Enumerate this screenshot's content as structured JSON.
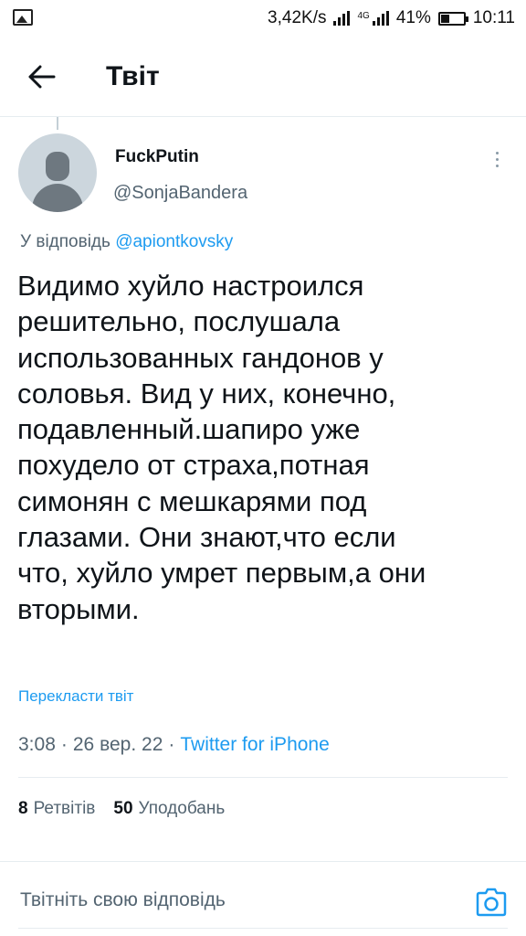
{
  "status_bar": {
    "network_speed": "3,42K/s",
    "network_type": "4G",
    "battery_percent": "41%",
    "battery_level": 0.41,
    "time": "10:11",
    "icons": [
      "gallery-icon",
      "signal-icon",
      "battery-icon"
    ]
  },
  "header": {
    "title": "Твіт",
    "back_icon": "arrow-left-icon"
  },
  "tweet": {
    "author_name": "FuckPutin",
    "author_handle": "@SonjaBandera",
    "reply_prefix": "У відповідь",
    "reply_to": "@apiontkovsky",
    "text": "Видимо хуйло настроился\nрешительно, послушала\nиспользованных гандонов у\nсоловья. Вид у них, конечно,\nподавленный.шапиро уже\nпохудело от страха,потная\nсимонян с мешкарями под\nглазами. Они знают,что если\nчто, хуйло умрет первым,а они\nвторыми.",
    "translate_label": "Перекласти твіт",
    "time": "3:08",
    "date": "26 вер. 22",
    "separator": "·",
    "source": "Twitter for iPhone",
    "retweets_count": "8",
    "retweets_label": "Ретвітів",
    "likes_count": "50",
    "likes_label": "Уподобань"
  },
  "reply_bar": {
    "placeholder": "Твітніть свою відповідь",
    "camera_icon": "camera-icon"
  },
  "colors": {
    "accent": "#1d9bf0",
    "secondary_text": "#536471",
    "primary_text": "#0f1419",
    "divider": "#e6ecf0"
  }
}
